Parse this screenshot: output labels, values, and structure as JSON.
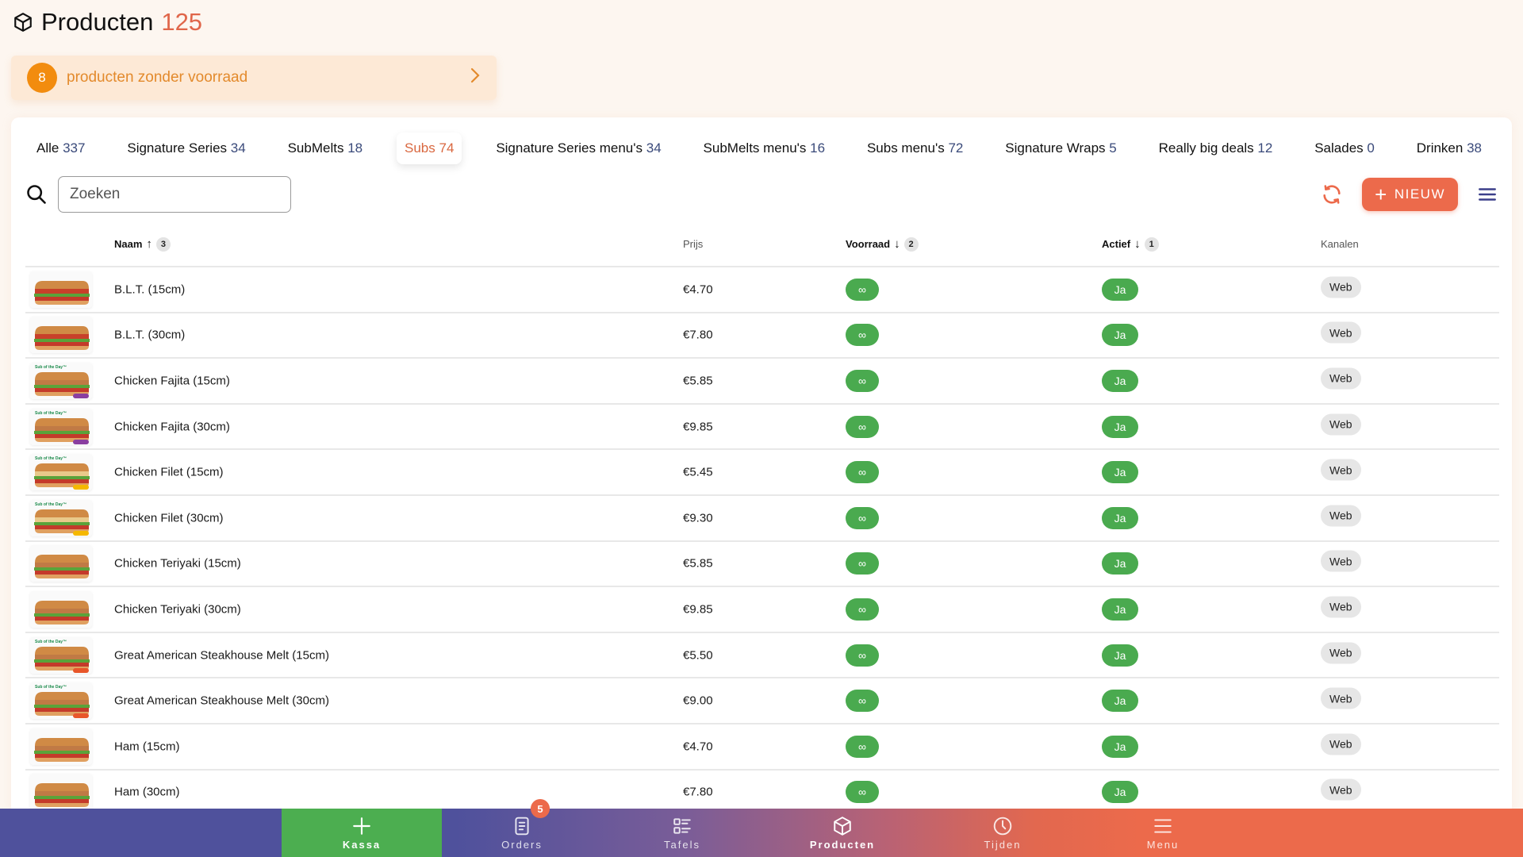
{
  "header": {
    "title": "Producten",
    "count": "125",
    "icon": "box-icon"
  },
  "alert": {
    "count": "8",
    "text": "producten zonder voorraad"
  },
  "tabs": [
    {
      "label": "Alle",
      "count": "337",
      "active": false
    },
    {
      "label": "Signature Series",
      "count": "34",
      "active": false
    },
    {
      "label": "SubMelts",
      "count": "18",
      "active": false
    },
    {
      "label": "Subs",
      "count": "74",
      "active": true
    },
    {
      "label": "Signature Series menu's",
      "count": "34",
      "active": false
    },
    {
      "label": "SubMelts menu's",
      "count": "16",
      "active": false
    },
    {
      "label": "Subs menu's",
      "count": "72",
      "active": false
    },
    {
      "label": "Signature Wraps",
      "count": "5",
      "active": false
    },
    {
      "label": "Really big deals",
      "count": "12",
      "active": false
    },
    {
      "label": "Salades",
      "count": "0",
      "active": false
    },
    {
      "label": "Drinken",
      "count": "38",
      "active": false
    }
  ],
  "search": {
    "placeholder": "Zoeken",
    "value": ""
  },
  "toolbar": {
    "new_label": "NIEUW"
  },
  "table": {
    "columns": {
      "name": {
        "label": "Naam",
        "sort": "asc",
        "priority": "3"
      },
      "price": {
        "label": "Prijs"
      },
      "stock": {
        "label": "Voorraad",
        "sort": "desc",
        "priority": "2"
      },
      "active": {
        "label": "Actief",
        "sort": "desc",
        "priority": "1"
      },
      "channels": {
        "label": "Kanalen"
      }
    },
    "rows": [
      {
        "name": "B.L.T. (15cm)",
        "price": "€4.70",
        "stock": "∞",
        "active": "Ja",
        "channel": "Web",
        "thumb": "blt"
      },
      {
        "name": "B.L.T. (30cm)",
        "price": "€7.80",
        "stock": "∞",
        "active": "Ja",
        "channel": "Web",
        "thumb": "blt"
      },
      {
        "name": "Chicken Fajita (15cm)",
        "price": "€5.85",
        "stock": "∞",
        "active": "Ja",
        "channel": "Web",
        "thumb": "sotd-purple"
      },
      {
        "name": "Chicken Fajita (30cm)",
        "price": "€9.85",
        "stock": "∞",
        "active": "Ja",
        "channel": "Web",
        "thumb": "sotd-purple"
      },
      {
        "name": "Chicken Filet (15cm)",
        "price": "€5.45",
        "stock": "∞",
        "active": "Ja",
        "channel": "Web",
        "thumb": "sotd-yellow"
      },
      {
        "name": "Chicken Filet (30cm)",
        "price": "€9.30",
        "stock": "∞",
        "active": "Ja",
        "channel": "Web",
        "thumb": "sotd-yellow"
      },
      {
        "name": "Chicken Teriyaki (15cm)",
        "price": "€5.85",
        "stock": "∞",
        "active": "Ja",
        "channel": "Web",
        "thumb": "plain"
      },
      {
        "name": "Chicken Teriyaki (30cm)",
        "price": "€9.85",
        "stock": "∞",
        "active": "Ja",
        "channel": "Web",
        "thumb": "plain"
      },
      {
        "name": "Great American Steakhouse Melt (15cm)",
        "price": "€5.50",
        "stock": "∞",
        "active": "Ja",
        "channel": "Web",
        "thumb": "sotd-orange"
      },
      {
        "name": "Great American Steakhouse Melt (30cm)",
        "price": "€9.00",
        "stock": "∞",
        "active": "Ja",
        "channel": "Web",
        "thumb": "sotd-orange"
      },
      {
        "name": "Ham (15cm)",
        "price": "€4.70",
        "stock": "∞",
        "active": "Ja",
        "channel": "Web",
        "thumb": "plain"
      },
      {
        "name": "Ham (30cm)",
        "price": "€7.80",
        "stock": "∞",
        "active": "Ja",
        "channel": "Web",
        "thumb": "plain"
      }
    ]
  },
  "bottom_nav": {
    "items": [
      {
        "label": "Kassa",
        "icon": "plus-icon"
      },
      {
        "label": "Orders",
        "icon": "receipt-icon",
        "badge": "5"
      },
      {
        "label": "Tafels",
        "icon": "tables-icon"
      },
      {
        "label": "Producten",
        "icon": "box-icon"
      },
      {
        "label": "Tijden",
        "icon": "clock-icon"
      },
      {
        "label": "Menu",
        "icon": "menu-icon"
      }
    ]
  },
  "colors": {
    "accent": "#ec6a4b",
    "success": "#4aaa4f",
    "nav_start": "#4f519c",
    "alert_bg": "#fde9d6",
    "alert_badge": "#f28c0f"
  }
}
